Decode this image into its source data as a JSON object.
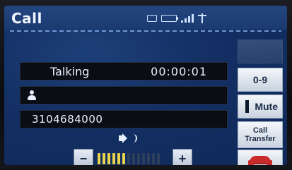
{
  "header": {
    "title": "Call",
    "icons": [
      "phone-icon",
      "battery-icon",
      "signal-icon",
      "antenna-icon"
    ]
  },
  "call": {
    "status": "Talking",
    "timer": "00:00:01",
    "contact_name": "",
    "number": "3104684000"
  },
  "volume": {
    "minus_label": "−",
    "plus_label": "+",
    "level_segments": 13,
    "level_on": 6
  },
  "sidebar": {
    "top_label": "",
    "keypad_label": "0-9",
    "mute_label": "Mute",
    "transfer_label": "Call\nTransfer",
    "end_icon": "end-call-icon"
  },
  "colors": {
    "screen_bg": "#132f63",
    "header_bg": "#1b3a70",
    "accent_volume": "#e7d34c",
    "end_call": "#c92a2a"
  }
}
